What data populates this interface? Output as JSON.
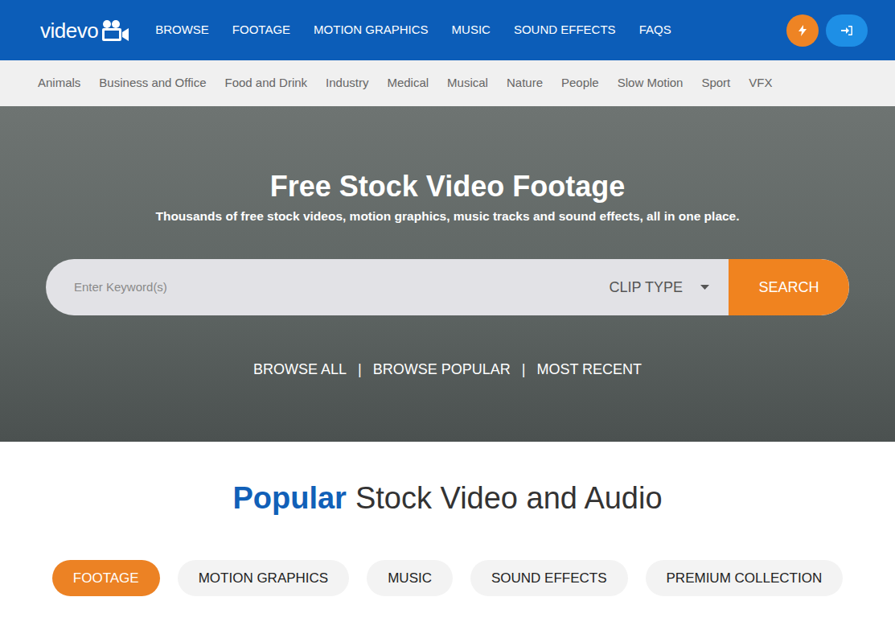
{
  "logo": {
    "text": "videvo"
  },
  "nav": {
    "items": [
      "BROWSE",
      "FOOTAGE",
      "MOTION GRAPHICS",
      "MUSIC",
      "SOUND EFFECTS",
      "FAQS"
    ]
  },
  "categories": [
    "Animals",
    "Business and Office",
    "Food and Drink",
    "Industry",
    "Medical",
    "Musical",
    "Nature",
    "People",
    "Slow Motion",
    "Sport",
    "VFX"
  ],
  "hero": {
    "title": "Free Stock Video Footage",
    "subtitle": "Thousands of free stock videos, motion graphics, music tracks and sound effects, all in one place.",
    "search": {
      "placeholder": "Enter Keyword(s)",
      "clip_type": "CLIP TYPE",
      "button": "SEARCH"
    },
    "links": [
      "BROWSE ALL",
      "BROWSE POPULAR",
      "MOST RECENT"
    ],
    "separator": "|"
  },
  "section": {
    "title_highlight": "Popular",
    "title_rest": "Stock Video and Audio"
  },
  "tabs": [
    {
      "label": "FOOTAGE",
      "selected": true
    },
    {
      "label": "MOTION GRAPHICS",
      "selected": false
    },
    {
      "label": "MUSIC",
      "selected": false
    },
    {
      "label": "SOUND EFFECTS",
      "selected": false
    },
    {
      "label": "PREMIUM COLLECTION",
      "selected": false
    }
  ]
}
